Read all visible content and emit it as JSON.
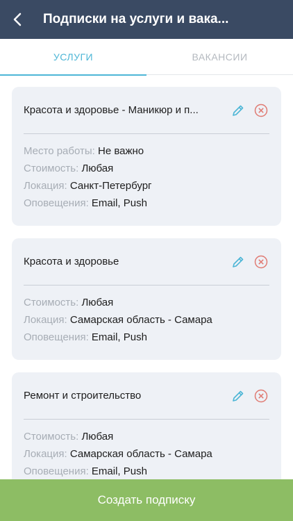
{
  "header": {
    "title": "Подписки на услуги и вака..."
  },
  "tabs": [
    {
      "label": "УСЛУГИ",
      "active": true
    },
    {
      "label": "ВАКАНСИИ",
      "active": false
    }
  ],
  "subscriptions": [
    {
      "title": "Красота и здоровье - Маникюр и п...",
      "fields": [
        {
          "label": "Место работы:",
          "value": "Не важно"
        },
        {
          "label": "Стоимость:",
          "value": "Любая"
        },
        {
          "label": "Локация:",
          "value": "Санкт-Петербург"
        },
        {
          "label": "Оповещения:",
          "value": "Email, Push"
        }
      ]
    },
    {
      "title": "Красота и здоровье",
      "fields": [
        {
          "label": "Стоимость:",
          "value": "Любая"
        },
        {
          "label": "Локация:",
          "value": "Самарская область - Самара"
        },
        {
          "label": "Оповещения:",
          "value": "Email, Push"
        }
      ]
    },
    {
      "title": "Ремонт и строительство",
      "fields": [
        {
          "label": "Стоимость:",
          "value": "Любая"
        },
        {
          "label": "Локация:",
          "value": "Самарская область - Самара"
        },
        {
          "label": "Оповещения:",
          "value": "Email, Push"
        }
      ]
    }
  ],
  "footer": {
    "create_label": "Создать подписку"
  },
  "icons": {
    "back": "chevron-left-icon",
    "edit": "pencil-icon",
    "delete": "close-circle-icon"
  },
  "colors": {
    "header": "#3a4a63",
    "accent": "#4db6d6",
    "delete": "#e07a72",
    "footer": "#8dbd64",
    "card": "#eef1f6"
  }
}
